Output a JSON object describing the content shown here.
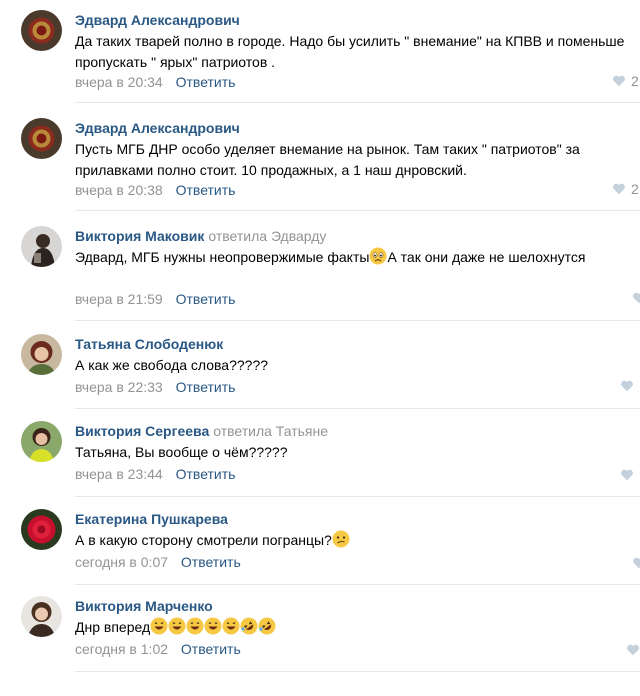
{
  "comments": [
    {
      "author": "Эдвард Александрович",
      "replied_to": "",
      "text": "Да таких тварей полно в городе. Надо бы усилить \" внемание\" на КПВВ и поменьше пропускать \" ярых\" патриотов .",
      "date": "вчера в 20:34",
      "reply_label": "Ответить",
      "likes": "2",
      "avatar_icon": "soviet-emblem-avatar"
    },
    {
      "author": "Эдвард Александрович",
      "replied_to": "",
      "text": "Пусть МГБ ДНР особо уделяет внемание на рынок. Там таких \" патриотов\" за прилавками полно стоит. 10 продажных, а 1 наш днровский.",
      "date": "вчера в 20:38",
      "reply_label": "Ответить",
      "likes": "2",
      "avatar_icon": "soviet-emblem-avatar"
    },
    {
      "author": "Виктория Маковик",
      "replied_to": "ответила Эдварду",
      "text_before_emoji": "Эдвард, МГБ нужны неопровержимые факты",
      "text_after_emoji": "А так они даже не шелохнутся",
      "emoji": "anxious-face",
      "date": "вчера в 21:59",
      "reply_label": "Ответить",
      "likes": "",
      "avatar_icon": "woman-dark-photo-avatar"
    },
    {
      "author": "Татьяна Слободенюк",
      "replied_to": "",
      "text": "А как же свобода слова?????",
      "date": "вчера в 22:33",
      "reply_label": "Ответить",
      "likes": "",
      "avatar_icon": "woman-red-hair-avatar"
    },
    {
      "author": "Виктория Сергеева",
      "replied_to": "ответила Татьяне",
      "text": "Татьяна, Вы вообще о чём?????",
      "date": "вчера в 23:44",
      "reply_label": "Ответить",
      "likes": "",
      "avatar_icon": "woman-outdoor-avatar"
    },
    {
      "author": "Екатерина Пушкарева",
      "replied_to": "",
      "text": "А в какую сторону смотрели погранцы?",
      "emoji": "confused-face",
      "date": "сегодня в 0:07",
      "reply_label": "Ответить",
      "likes": "",
      "avatar_icon": "red-rose-avatar"
    },
    {
      "author": "Виктория Марченко",
      "replied_to": "",
      "text": "Днр вперед",
      "emojis": [
        "grinning-face",
        "grinning-face",
        "grinning-face",
        "grinning-face",
        "grinning-face",
        "rofl-face",
        "rofl-face"
      ],
      "date": "сегодня в 1:02",
      "reply_label": "Ответить",
      "likes": "",
      "avatar_icon": "woman-portrait-avatar"
    }
  ],
  "colors": {
    "author": "#2a5885",
    "muted": "#939393",
    "separator": "#e7e8ec",
    "heart": "#c4d0dc"
  }
}
